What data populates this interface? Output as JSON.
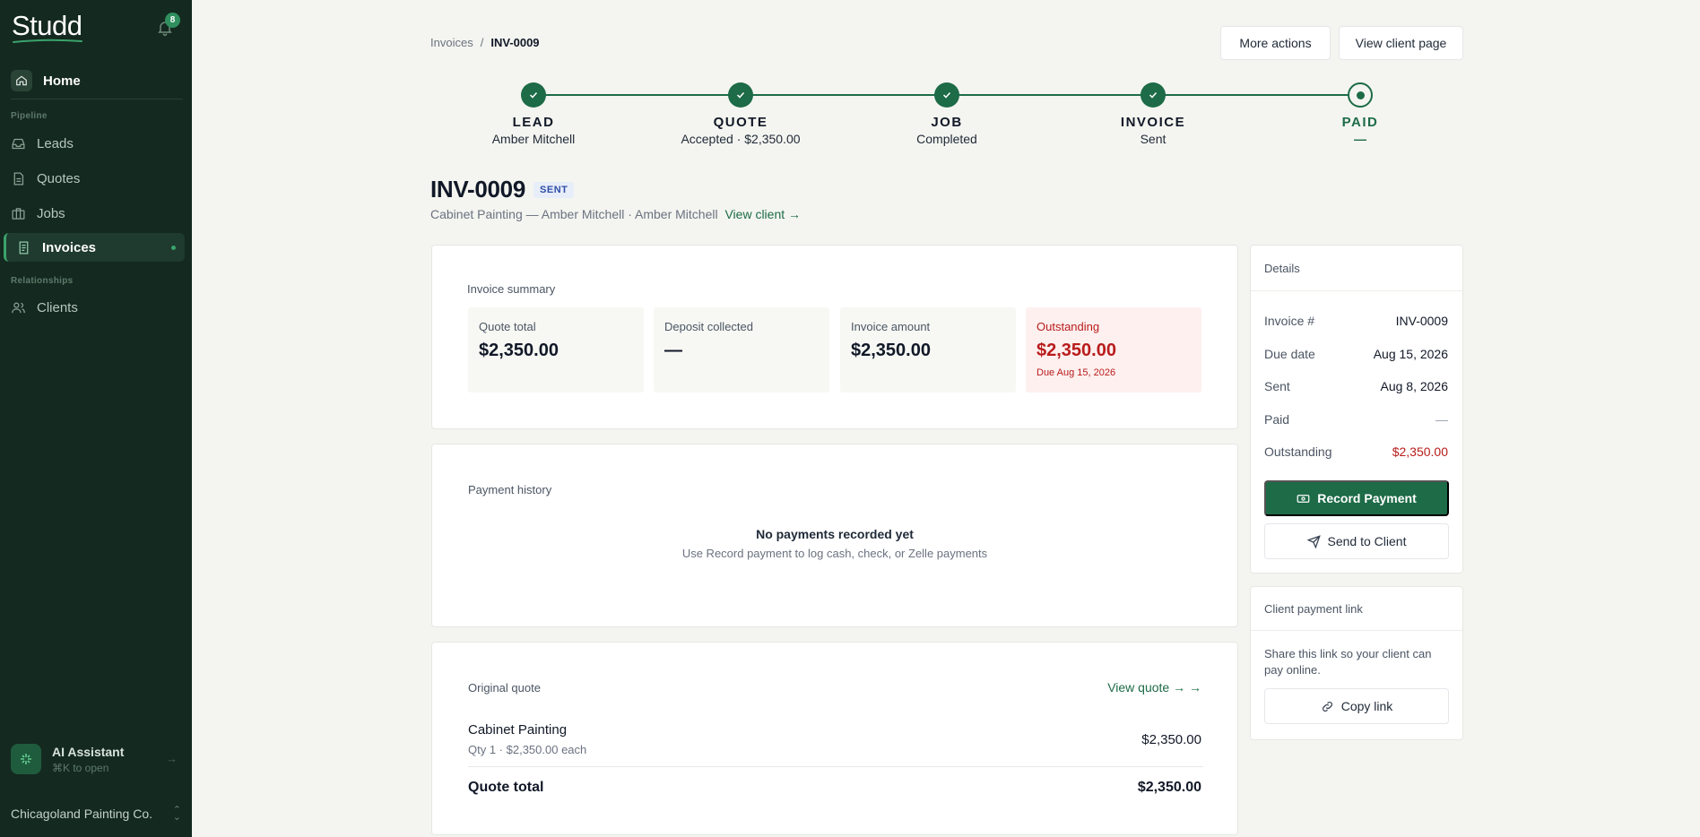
{
  "sidebar": {
    "brand": "Studd",
    "notification_count": "8",
    "home_label": "Home",
    "section_pipeline": "Pipeline",
    "section_relationships": "Relationships",
    "items": [
      {
        "label": "Leads"
      },
      {
        "label": "Quotes"
      },
      {
        "label": "Jobs"
      },
      {
        "label": "Invoices"
      },
      {
        "label": "Clients"
      }
    ],
    "assistant_title": "AI Assistant",
    "assistant_shortcut": "⌘K to open",
    "organization": "Chicagoland Painting Co."
  },
  "breadcrumb": {
    "parent": "Invoices",
    "separator": "/",
    "current": "INV-0009"
  },
  "actions": {
    "more_actions": "More actions",
    "view_client_page": "View client page"
  },
  "stepper": [
    {
      "name": "LEAD",
      "sub": "Amber Mitchell",
      "status": "done"
    },
    {
      "name": "QUOTE",
      "sub": "Accepted · $2,350.00",
      "status": "done"
    },
    {
      "name": "JOB",
      "sub": "Completed",
      "status": "done"
    },
    {
      "name": "INVOICE",
      "sub": "Sent",
      "status": "done"
    },
    {
      "name": "PAID",
      "sub": "—",
      "status": "current"
    }
  ],
  "invoice": {
    "number": "INV-0009",
    "status_badge": "SENT",
    "subtitle": "Cabinet Painting — Amber Mitchell · Amber Mitchell",
    "view_client_link": "View client →"
  },
  "summary": {
    "title": "Invoice summary",
    "quote_total_label": "Quote total",
    "quote_total_value": "$2,350.00",
    "deposit_label": "Deposit collected",
    "deposit_value": "—",
    "invoice_amount_label": "Invoice amount",
    "invoice_amount_value": "$2,350.00",
    "outstanding_label": "Outstanding",
    "outstanding_value": "$2,350.00",
    "outstanding_due": "Due Aug 15, 2026"
  },
  "payment_history": {
    "title": "Payment history",
    "empty_title": "No payments recorded yet",
    "empty_sub": "Use Record payment to log cash, check, or Zelle payments"
  },
  "original_quote": {
    "title": "Original quote",
    "view_link": "View quote → →",
    "item_name": "Cabinet Painting",
    "item_meta": "Qty 1 · $2,350.00 each",
    "item_amount": "$2,350.00",
    "total_label": "Quote total",
    "total_value": "$2,350.00"
  },
  "details": {
    "title": "Details",
    "rows": [
      {
        "k": "Invoice #",
        "v": "INV-0009"
      },
      {
        "k": "Due date",
        "v": "Aug 15, 2026"
      },
      {
        "k": "Sent",
        "v": "Aug 8, 2026"
      },
      {
        "k": "Paid",
        "v": "—"
      },
      {
        "k": "Outstanding",
        "v": "$2,350.00"
      }
    ],
    "record_payment": "Record Payment",
    "send_to_client": "Send to Client"
  },
  "payment_link": {
    "title": "Client payment link",
    "description": "Share this link so your client can pay online.",
    "copy": "Copy link"
  },
  "colors": {
    "sidebar_bg": "#14291f",
    "brand_green": "#1d6b47",
    "alert_red": "#b91c1c"
  }
}
